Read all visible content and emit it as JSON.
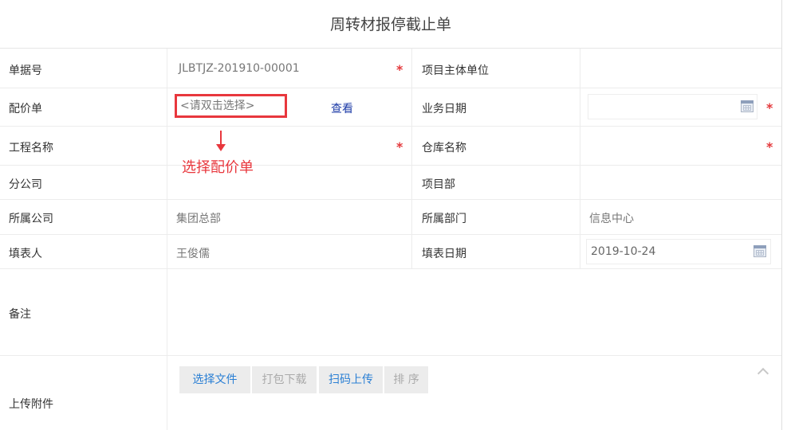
{
  "title": "周转材报停截止单",
  "fields": {
    "doc_no_label": "单据号",
    "doc_no_value": "JLBTJZ-201910-00001",
    "project_unit_label": "项目主体单位",
    "price_list_label": "配价单",
    "price_list_placeholder": "<请双击选择>",
    "view_link": "查看",
    "business_date_label": "业务日期",
    "project_name_label": "工程名称",
    "warehouse_label": "仓库名称",
    "branch_label": "分公司",
    "project_dept_label": "项目部",
    "company_label": "所属公司",
    "company_value": "集团总部",
    "department_label": "所属部门",
    "department_value": "信息中心",
    "filler_label": "填表人",
    "filler_value": "王俊儒",
    "fill_date_label": "填表日期",
    "fill_date_value": "2019-10-24",
    "remark_label": "备注",
    "attachment_label": "上传附件"
  },
  "required_mark": "*",
  "annotation": {
    "text": "选择配价单"
  },
  "attachment_buttons": {
    "select_file": "选择文件",
    "pack_download": "打包下载",
    "scan_upload": "扫码上传",
    "sort": "排 序"
  },
  "colors": {
    "required": "#e4393c",
    "annotation": "#e8373d",
    "link": "#1b3aa6",
    "button_active": "#2a7fd4",
    "button_disabled": "#aaaaaa"
  }
}
